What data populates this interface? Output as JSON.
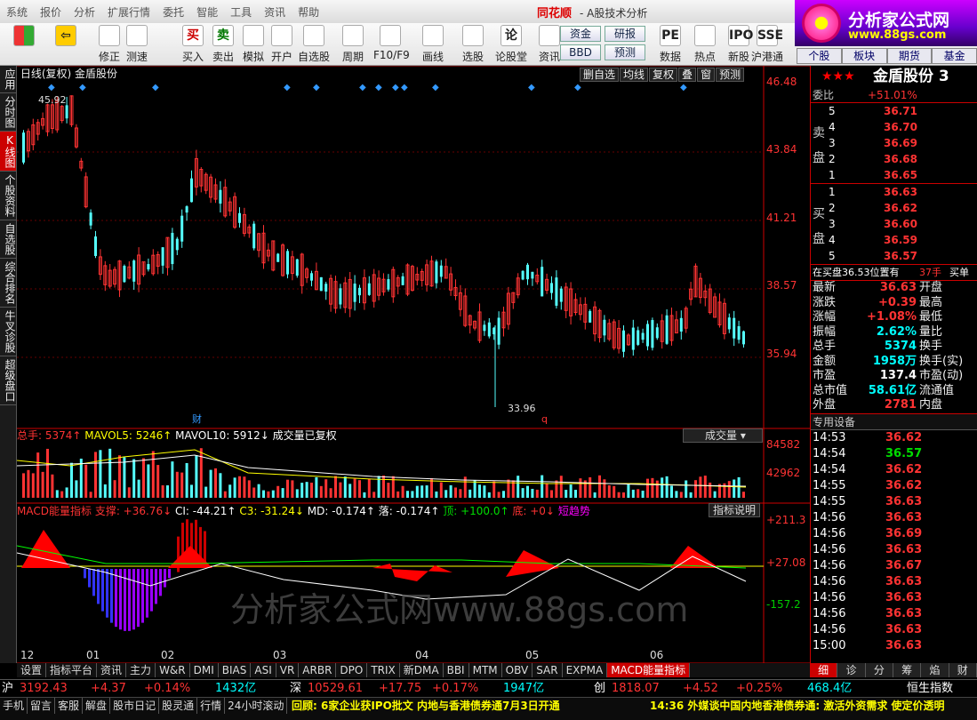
{
  "menu": [
    "系统",
    "报价",
    "分析",
    "扩展行情",
    "委托",
    "智能",
    "工具",
    "资讯",
    "帮助"
  ],
  "brand": "同花顺",
  "window_title": "- A股技术分析",
  "logo": {
    "line1": "分析家公式网",
    "line2": "www.88gs.com"
  },
  "toolbar": [
    {
      "label": "",
      "icon": "grid-icon"
    },
    {
      "label": "",
      "icon": "back-arrow-icon"
    },
    {
      "label": "修正",
      "icon": "up-down-icon"
    },
    {
      "label": "测速",
      "icon": "clock-icon"
    },
    {
      "label": "买入",
      "icon": "buy-icon",
      "glyph": "买"
    },
    {
      "label": "卖出",
      "icon": "sell-icon",
      "glyph": "卖"
    },
    {
      "label": "模拟",
      "icon": "hammer-icon"
    },
    {
      "label": "开户",
      "icon": "lock-icon"
    },
    {
      "label": "自选股",
      "icon": "star-icon"
    },
    {
      "label": "周期",
      "icon": "clock-icon"
    },
    {
      "label": "F10/F9",
      "icon": "f10-icon"
    },
    {
      "label": "画线",
      "icon": "pen-icon"
    },
    {
      "label": "选股",
      "icon": "monitor-icon"
    },
    {
      "label": "论股堂",
      "icon": "chat-icon",
      "glyph": "论"
    },
    {
      "label": "资讯",
      "icon": "news-icon"
    },
    {
      "label": "数据",
      "icon": "pe-icon",
      "glyph": "PE"
    },
    {
      "label": "热点",
      "icon": "fire-icon"
    },
    {
      "label": "新股",
      "icon": "ipo-icon",
      "glyph": "IPO"
    },
    {
      "label": "沪港通",
      "icon": "sse-icon",
      "glyph": "SSE"
    }
  ],
  "toolbar_buttons": [
    "资金",
    "研报",
    "BBD",
    "预测"
  ],
  "right_tabs": [
    "个股",
    "板块",
    "期货",
    "基金"
  ],
  "left_tabs": [
    {
      "label": "应用"
    },
    {
      "label": "分时图"
    },
    {
      "label": "K线图",
      "active": true
    },
    {
      "label": "个股资料"
    },
    {
      "label": "自选股"
    },
    {
      "label": "综合排名"
    },
    {
      "label": "牛叉诊股"
    },
    {
      "label": "超级盘口"
    }
  ],
  "chart_header": "日线(复权) 金盾股份",
  "chart_tabs": [
    "删自选",
    "均线",
    "复权",
    "叠",
    "窗",
    "预测"
  ],
  "volume_header": {
    "total": "总手: 5374↑",
    "mavol5": "MAVOL5: 5246↑",
    "mavol10": "MAVOL10: 5912↓",
    "note": "成交量已复权",
    "dropdown": "成交量"
  },
  "macd_header": {
    "name": "MACD能量指标",
    "items": [
      "支撑: +36.76↓",
      "CI: -44.21↑",
      "C3: -31.24↓",
      "MD: -0.174↑",
      "落: -0.174↑",
      "顶: +100.0↑",
      "底: +0↓",
      "短趋势"
    ],
    "btn": "指标说明"
  },
  "price_axis": [
    "46.48",
    "43.84",
    "41.21",
    "38.57",
    "35.94"
  ],
  "vol_axis": [
    "84582",
    "42962"
  ],
  "macd_axis": [
    "+211.3",
    "+27.08",
    "-157.2"
  ],
  "time_axis": [
    "12",
    "01",
    "02",
    "03",
    "04",
    "05",
    "06"
  ],
  "annotations": {
    "high": "45.92",
    "low": "33.96",
    "mark": "财",
    "q": "q"
  },
  "watermark": "分析家公式网www.88gs.com",
  "quote": {
    "name": "金盾股份",
    "code": "3",
    "webi": {
      "label": "委比",
      "value": "+51.01%"
    },
    "sell": [
      {
        "n": "5",
        "p": "36.71"
      },
      {
        "n": "4",
        "p": "36.70"
      },
      {
        "n": "3",
        "p": "36.69"
      },
      {
        "n": "2",
        "p": "36.68"
      },
      {
        "n": "1",
        "p": "36.65"
      }
    ],
    "buy": [
      {
        "n": "1",
        "p": "36.63"
      },
      {
        "n": "2",
        "p": "36.62"
      },
      {
        "n": "3",
        "p": "36.60"
      },
      {
        "n": "4",
        "p": "36.59"
      },
      {
        "n": "5",
        "p": "36.57"
      }
    ],
    "sell_label": "卖盘",
    "buy_label": "买盘",
    "note": "在买盘36.53位置有",
    "note2": "37手",
    "note3": "买单",
    "stats": [
      [
        "最新",
        "36.63",
        "开盘",
        ""
      ],
      [
        "涨跌",
        "+0.39",
        "最高",
        ""
      ],
      [
        "涨幅",
        "+1.08%",
        "最低",
        ""
      ],
      [
        "振幅",
        "2.62%",
        "量比",
        ""
      ],
      [
        "总手",
        "5374",
        "换手",
        ""
      ],
      [
        "金额",
        "1958万",
        "换手(实)",
        ""
      ],
      [
        "市盈",
        "137.4",
        "市盈(动)",
        ""
      ],
      [
        "总市值",
        "58.61亿",
        "流通值",
        ""
      ],
      [
        "外盘",
        "2781",
        "内盘",
        ""
      ]
    ],
    "ticks_header": "专用设备",
    "ticks": [
      [
        "14:53",
        "36.62"
      ],
      [
        "14:54",
        "36.57"
      ],
      [
        "14:54",
        "36.62"
      ],
      [
        "14:55",
        "36.62"
      ],
      [
        "14:55",
        "36.63"
      ],
      [
        "14:56",
        "36.63"
      ],
      [
        "14:56",
        "36.69"
      ],
      [
        "14:56",
        "36.63"
      ],
      [
        "14:56",
        "36.67"
      ],
      [
        "14:56",
        "36.63"
      ],
      [
        "14:56",
        "36.63"
      ],
      [
        "14:56",
        "36.63"
      ],
      [
        "14:56",
        "36.63"
      ],
      [
        "15:00",
        "36.63"
      ]
    ]
  },
  "bottom_tabs": [
    "设置",
    "指标平台",
    "资讯",
    "主力",
    "W&R",
    "DMI",
    "BIAS",
    "ASI",
    "VR",
    "ARBR",
    "DPO",
    "TRIX",
    "新DMA",
    "BBI",
    "MTM",
    "OBV",
    "SAR",
    "EXPMA",
    "MACD能量指标"
  ],
  "right_bottom_tabs": [
    "细",
    "诊",
    "分",
    "筹",
    "焰",
    "财"
  ],
  "index_bar": [
    {
      "n": "沪",
      "v": "3192.43",
      "c": "+4.37",
      "p": "+0.14%",
      "a": "1432亿"
    },
    {
      "n": "深",
      "v": "10529.61",
      "c": "+17.75",
      "p": "+0.17%",
      "a": "1947亿"
    },
    {
      "n": "创",
      "v": "1818.07",
      "c": "+4.52",
      "p": "+0.25%",
      "a": "468.4亿"
    },
    {
      "n": "恒生指数",
      "v": "",
      "c": "",
      "p": "",
      "a": ""
    }
  ],
  "status_tabs": [
    "手机",
    "留言",
    "客服",
    "解盘",
    "股市日记",
    "股灵通",
    "行情",
    "24小时滚动"
  ],
  "ticker": "回顾: 6家企业获IPO批文 内地与香港债券通7月3日开通",
  "ticker2": "14:36 外媒谈中国内地香港债券通: 激活外资需求 使定价透明"
}
